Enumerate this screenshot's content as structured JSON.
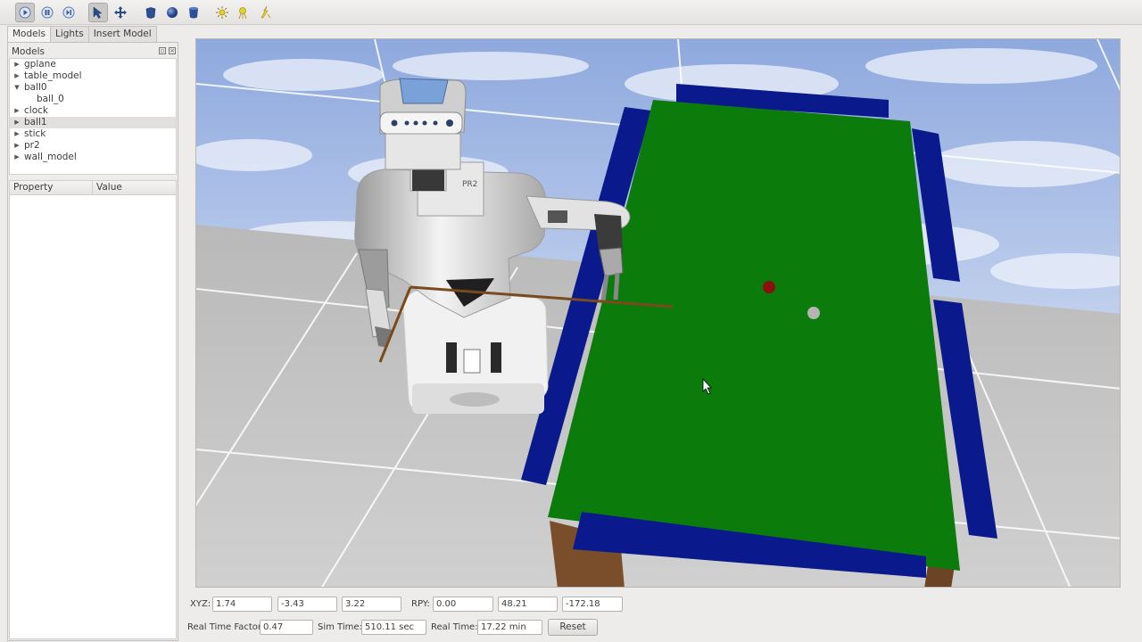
{
  "toolbar": {
    "buttons": [
      {
        "icon": "play-icon"
      },
      {
        "icon": "pause-icon"
      },
      {
        "icon": "step-icon"
      },
      {
        "icon": "select-arrow-icon"
      },
      {
        "icon": "translate-icon"
      },
      {
        "icon": "box-icon"
      },
      {
        "icon": "sphere-icon"
      },
      {
        "icon": "cylinder-icon"
      },
      {
        "icon": "point-light-icon"
      },
      {
        "icon": "spot-light-icon"
      },
      {
        "icon": "directional-light-icon"
      }
    ]
  },
  "tabs": {
    "models": "Models",
    "lights": "Lights",
    "insert_model": "Insert Model"
  },
  "models_panel": {
    "header": "Models",
    "items": [
      {
        "label": "gplane",
        "expanded": false
      },
      {
        "label": "table_model",
        "expanded": false
      },
      {
        "label": "ball0",
        "expanded": true
      },
      {
        "label": "ball_0",
        "child": true
      },
      {
        "label": "clock",
        "expanded": false
      },
      {
        "label": "ball1",
        "expanded": false,
        "selected": true
      },
      {
        "label": "stick",
        "expanded": false
      },
      {
        "label": "pr2",
        "expanded": false
      },
      {
        "label": "wall_model",
        "expanded": false
      }
    ]
  },
  "properties": {
    "col_property": "Property",
    "col_value": "Value"
  },
  "pose": {
    "xyz_label": "XYZ:",
    "x": "1.74",
    "y": "-3.43",
    "z": "3.22",
    "rpy_label": "RPY:",
    "roll": "0.00",
    "pitch": "48.21",
    "yaw": "-172.18"
  },
  "time": {
    "rtf_label": "Real Time Factor:",
    "rtf": "0.47",
    "sim_label": "Sim Time:",
    "sim": "510.11 sec",
    "real_label": "Real Time:",
    "real": "17.22 min",
    "reset": "Reset"
  },
  "colors": {
    "table_felt": "#0a7a0a",
    "table_rail": "#0a1a8c",
    "sky": "#a9bfe8",
    "ground": "#c6c6c6",
    "ball_red": "#8b1010",
    "ball_white": "#b4b4b4",
    "stick": "#7a4a1e"
  },
  "robot_label": "PR2"
}
